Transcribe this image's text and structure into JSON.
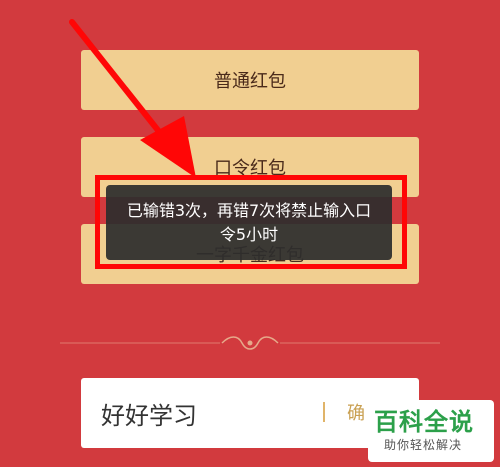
{
  "buttons": {
    "normal_red_packet": "普通红包",
    "password_red_packet": "口令红包",
    "word_gold_red_packet": "一字千金红包"
  },
  "toast": {
    "message": "已输错3次，再错7次将禁止输入口令5小时"
  },
  "input": {
    "value": "好好学习",
    "confirm_label": "确"
  },
  "watermark": {
    "title": "百科全说",
    "subtitle": "助你轻松解决"
  },
  "colors": {
    "background": "#d23a3e",
    "button": "#f1cf91",
    "highlight": "#ff0606",
    "toast_bg": "#2d2d2d"
  },
  "icons": [
    "arrow-annotation-icon",
    "ornament-divider-icon"
  ]
}
